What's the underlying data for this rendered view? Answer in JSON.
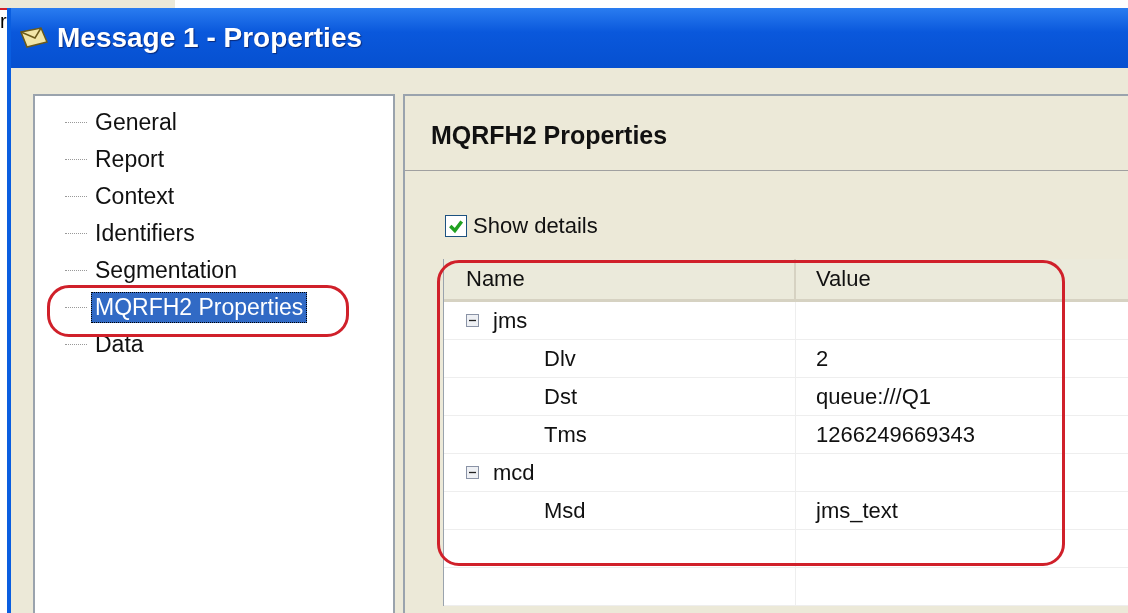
{
  "background_text": "r",
  "window": {
    "title": "Message 1 - Properties"
  },
  "nav": {
    "items": [
      {
        "label": "General",
        "selected": false
      },
      {
        "label": "Report",
        "selected": false
      },
      {
        "label": "Context",
        "selected": false
      },
      {
        "label": "Identifiers",
        "selected": false
      },
      {
        "label": "Segmentation",
        "selected": false
      },
      {
        "label": "MQRFH2 Properties",
        "selected": true
      },
      {
        "label": "Data",
        "selected": false
      }
    ]
  },
  "page": {
    "heading": "MQRFH2 Properties",
    "show_details": {
      "label": "Show details",
      "checked": true
    },
    "table": {
      "columns": [
        "Name",
        "Value"
      ],
      "rows": [
        {
          "name": "jms",
          "expanded": true,
          "children": [
            {
              "name": "Dlv",
              "value": "2"
            },
            {
              "name": "Dst",
              "value": "queue:///Q1"
            },
            {
              "name": "Tms",
              "value": "1266249669343"
            }
          ]
        },
        {
          "name": "mcd",
          "expanded": true,
          "children": [
            {
              "name": "Msd",
              "value": "jms_text"
            }
          ]
        }
      ]
    }
  }
}
